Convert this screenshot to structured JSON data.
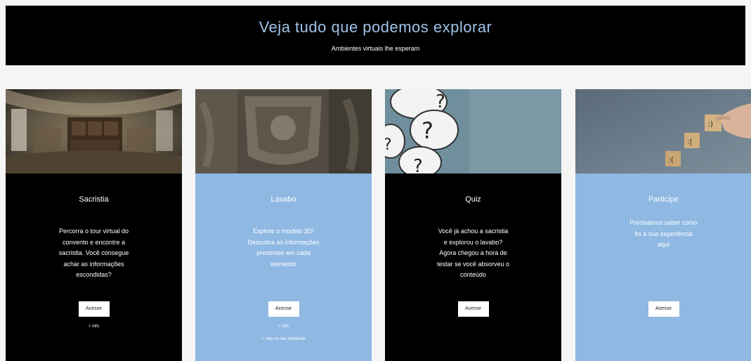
{
  "hero": {
    "title": "Veja tudo que podemos explorar",
    "subtitle": "Ambientes virtuais lhe esperam"
  },
  "colors": {
    "black_card": "#000000",
    "blue_card": "#8fb8e3",
    "hero_title": "#9fc3e7",
    "page_bg": "#f5f5f5"
  },
  "cards": [
    {
      "image_icon": "sacristy-interior-photo",
      "title": "Sacristia",
      "description": [
        "Percorra o tour virtual do",
        "convento e encontre a",
        "sacristia. Você consegue",
        "achar as informações",
        "escondidas?"
      ],
      "button": "Acesse",
      "links": [
        "+ info"
      ]
    },
    {
      "image_icon": "stone-carving-photo",
      "title": "Lavabo",
      "description": [
        "Explore o modelo 3D!",
        "Descubra as informações",
        "presentes em cada",
        "elemento"
      ],
      "button": "Acesse",
      "links": [
        "+ info",
        "+ veja no seu ambiente"
      ]
    },
    {
      "image_icon": "question-marks-photo",
      "title": "Quiz",
      "description": [
        "Você já achou a sacristia",
        "e explorou o lavabo?",
        "Agora chegou a hora de",
        "testar se você absorveu o",
        "conteúdo"
      ],
      "button": "Acesse",
      "links": []
    },
    {
      "image_icon": "feedback-faces-photo",
      "title": "Participe",
      "description": [
        "Precisamos saber como",
        "foi a sua experiência",
        "aqui"
      ],
      "button": "Acesse",
      "links": []
    }
  ]
}
